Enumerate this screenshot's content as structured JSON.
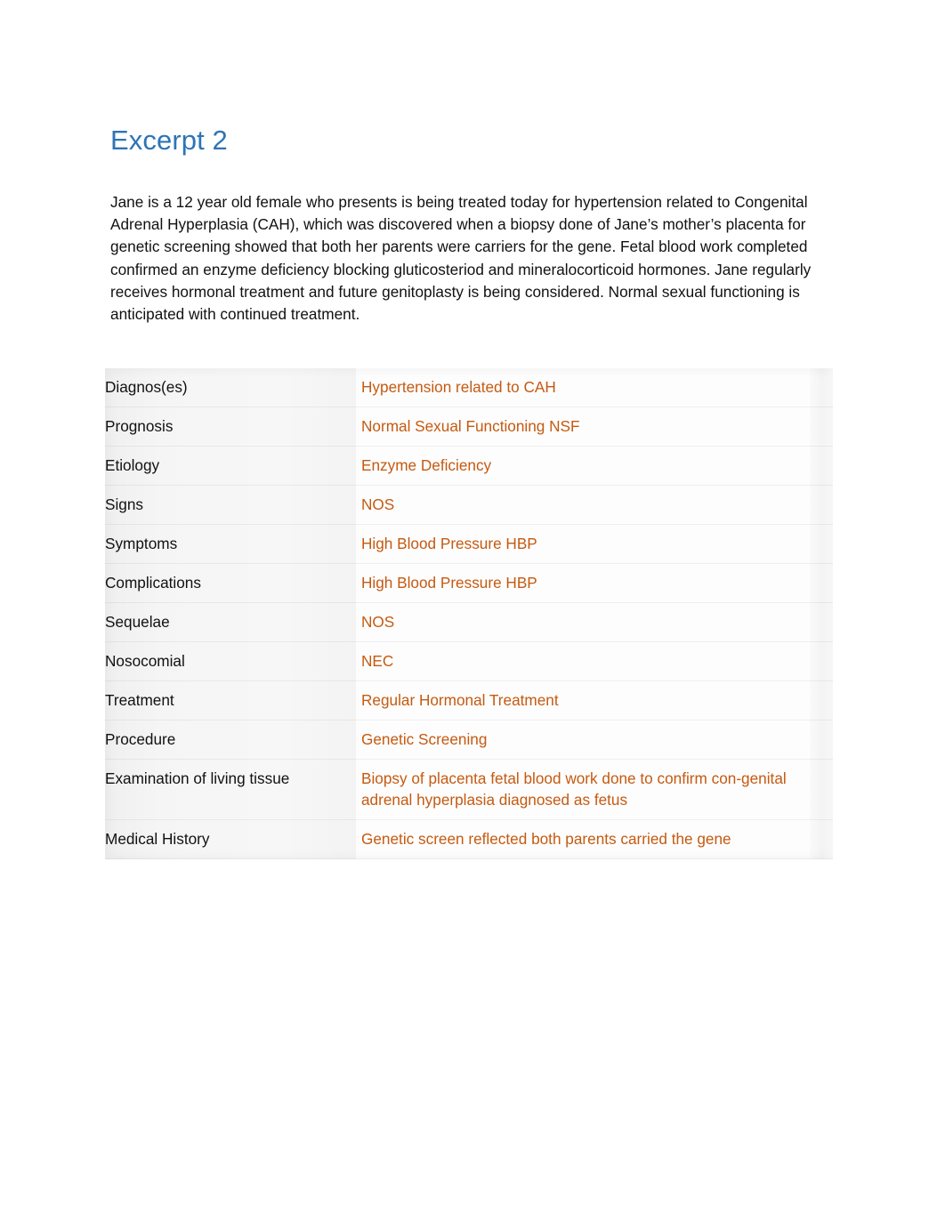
{
  "document": {
    "heading": "Excerpt 2",
    "paragraph": "Jane is a 12 year old female who presents is being treated today for hypertension related to Congenital Adrenal Hyperplasia (CAH), which was discovered when a biopsy done of Jane’s mother’s placenta for genetic screening showed that both her parents were carriers for the gene. Fetal blood work completed confirmed an enzyme deficiency blocking gluticosteriod and mineralocorticoid hormones. Jane regularly receives hormonal treatment and future genitoplasty is being considered. Normal sexual functioning is anticipated with continued treatment."
  },
  "colors": {
    "heading_blue": "#2E74B5",
    "value_orange": "#C55A11",
    "body_text": "#111111",
    "page_background": "#FFFFFF",
    "row_divider": "rgba(0,0,0,0.055)"
  },
  "table": {
    "rows": [
      {
        "label": "Diagnos(es)",
        "value": "Hypertension related to CAH",
        "tall": false
      },
      {
        "label": "Prognosis",
        "value": "Normal Sexual Functioning NSF",
        "tall": false
      },
      {
        "label": "Etiology",
        "value": "Enzyme Deficiency",
        "tall": false
      },
      {
        "label": "Signs",
        "value": "NOS",
        "tall": false
      },
      {
        "label": "Symptoms",
        "value": "High Blood Pressure HBP",
        "tall": false
      },
      {
        "label": "Complications",
        "value": "High Blood Pressure HBP",
        "tall": false
      },
      {
        "label": "Sequelae",
        "value": "NOS",
        "tall": false
      },
      {
        "label": "Nosocomial",
        "value": "NEC",
        "tall": false
      },
      {
        "label": "Treatment",
        "value": "Regular Hormonal Treatment",
        "tall": false
      },
      {
        "label": "Procedure",
        "value": "Genetic Screening",
        "tall": false
      },
      {
        "label": "Examination of living tissue",
        "value": "Biopsy of placenta fetal blood work done to confirm con-genital adrenal hyperplasia diagnosed as fetus",
        "tall": true
      },
      {
        "label": "Medical History",
        "value": "Genetic screen reflected both parents carried the gene",
        "tall": false
      }
    ]
  }
}
